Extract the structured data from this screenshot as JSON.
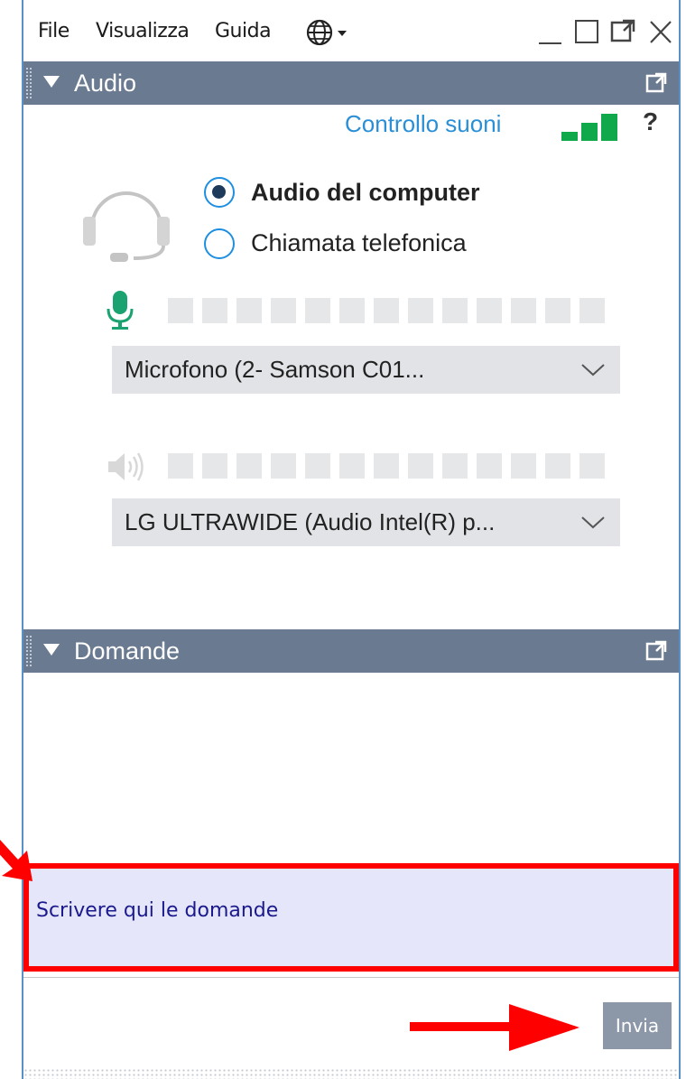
{
  "menu": {
    "file": "File",
    "view": "Visualizza",
    "help": "Guida"
  },
  "audio_panel": {
    "title": "Audio",
    "sound_check_label": "Controllo suoni",
    "help_symbol": "?",
    "options": [
      {
        "label": "Audio del computer",
        "selected": true
      },
      {
        "label": "Chiamata telefonica",
        "selected": false
      }
    ],
    "microphone_value": "Microfono (2- Samson C01...",
    "speaker_value": "LG ULTRAWIDE (Audio Intel(R) p...",
    "meter_level": 0,
    "icons": [
      "headset-icon",
      "microphone-icon",
      "speaker-icon",
      "signal-bars-icon"
    ]
  },
  "questions_panel": {
    "title": "Domande",
    "input_placeholder": "Scrivere qui le domande",
    "send_label": "Invia"
  },
  "colors": {
    "header_bg": "#6a7a90",
    "accent_blue": "#2a8fd6",
    "mic_green": "#1aa370",
    "signal_green": "#0fa84a",
    "highlight_red": "#ff0000"
  }
}
